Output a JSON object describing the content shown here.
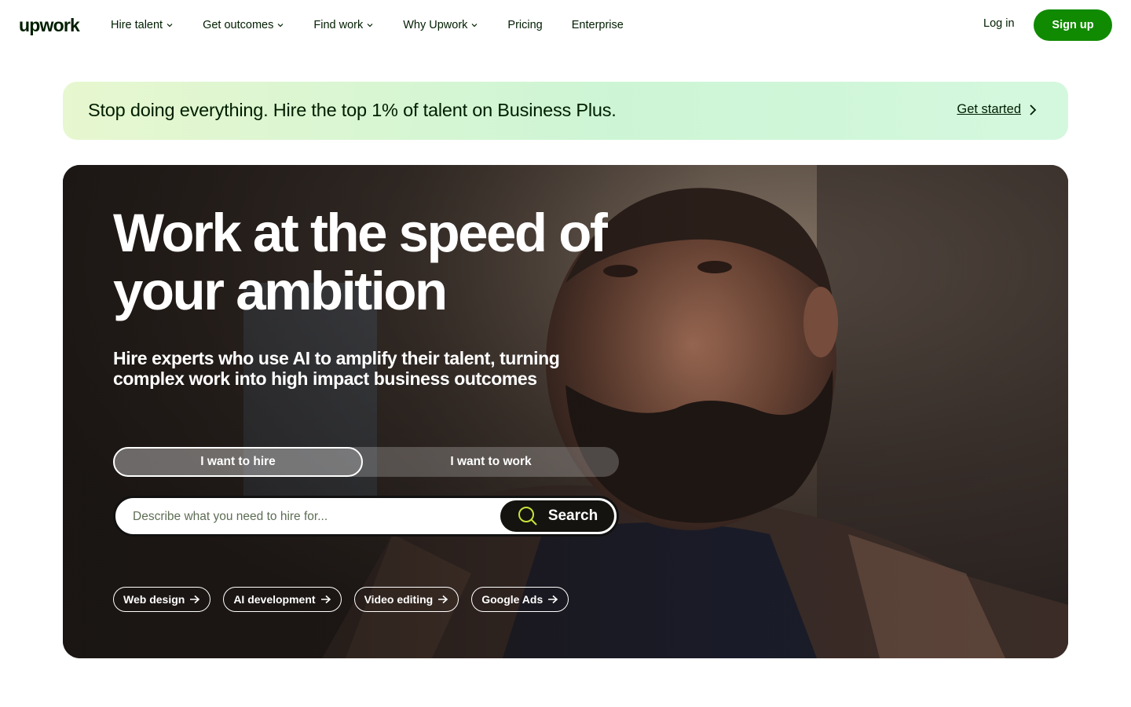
{
  "nav": {
    "logo": "upwork",
    "items": [
      {
        "label": "Hire talent",
        "dropdown": true
      },
      {
        "label": "Get outcomes",
        "dropdown": true
      },
      {
        "label": "Find work",
        "dropdown": true
      },
      {
        "label": "Why Upwork",
        "dropdown": true
      },
      {
        "label": "Pricing",
        "dropdown": false
      },
      {
        "label": "Enterprise",
        "dropdown": false
      }
    ],
    "login": "Log in",
    "signup": "Sign up"
  },
  "promo": {
    "text": "Stop doing everything. Hire the top 1% of talent on Business Plus.",
    "link": "Get started"
  },
  "hero": {
    "title_line1": "Work at the speed of",
    "title_line2": "your ambition",
    "subtitle_line1": "Hire experts who use AI to amplify their talent, turning",
    "subtitle_line2": "complex work into high impact business outcomes",
    "toggle": {
      "hire": "I want to hire",
      "work": "I want to work",
      "selected": "hire"
    },
    "search": {
      "placeholder": "Describe what you need to hire for...",
      "button": "Search"
    },
    "chips": [
      "Web design",
      "AI development",
      "Video editing",
      "Google Ads"
    ]
  },
  "colors": {
    "brand_green": "#108a00",
    "text_dark": "#001e00",
    "search_icon": "#c7e33a"
  }
}
